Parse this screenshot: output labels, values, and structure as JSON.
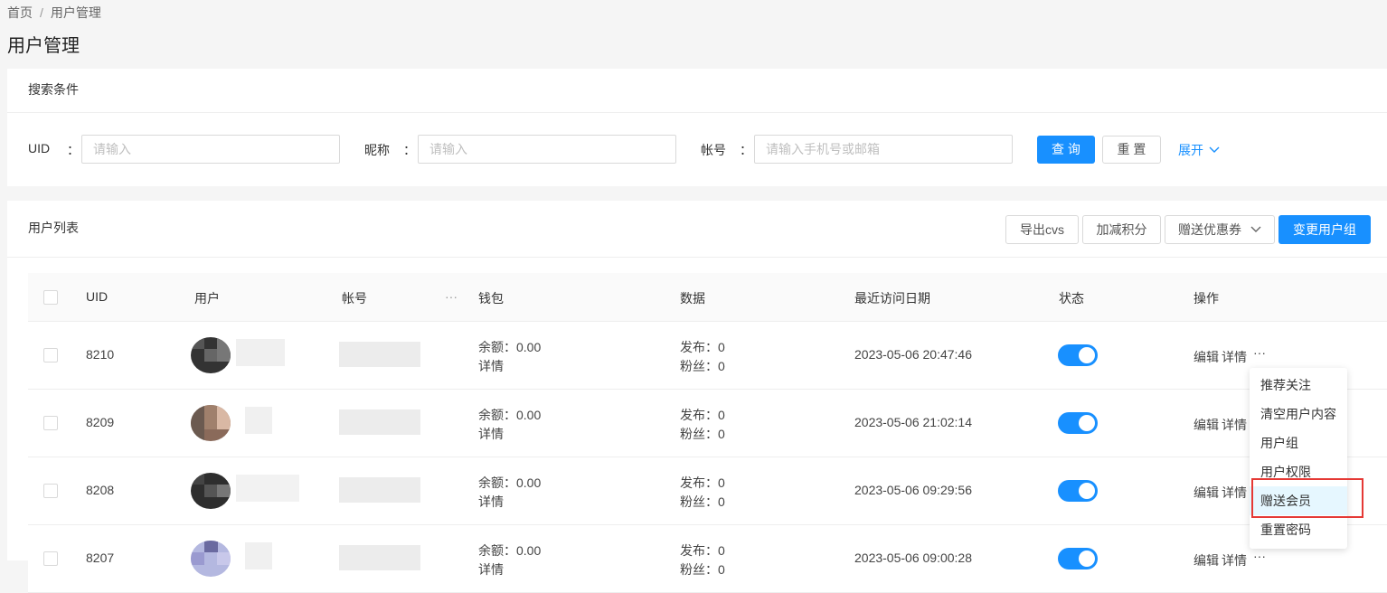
{
  "breadcrumb": {
    "home": "首页",
    "sep": "/",
    "current": "用户管理"
  },
  "page_title": "用户管理",
  "search": {
    "header": "搜索条件",
    "uid_label": "UID",
    "nickname_label": "昵称",
    "account_label": "帐号",
    "colon": "：",
    "uid_placeholder": "请输入",
    "nickname_placeholder": "请输入",
    "account_placeholder": "请输入手机号或邮箱",
    "query_button": "查 询",
    "reset_button": "重 置",
    "expand_link": "展开",
    "expand_icon": "chevron-down-icon"
  },
  "list": {
    "header": "用户列表",
    "export_button": "导出cvs",
    "points_button": "加减积分",
    "coupon_button": "赠送优惠券",
    "change_group_button": "变更用户组",
    "accent_color": "#1890ff",
    "columns": [
      "UID",
      "用户",
      "帐号",
      "钱包",
      "数据",
      "最近访问日期",
      "状态",
      "操作"
    ],
    "column_menu_icon": "···",
    "rows": [
      {
        "uid": "8210",
        "balance": "余额：0.00",
        "detail": "详情",
        "publish": "发布：0",
        "fans": "粉丝：0",
        "date": "2023-05-06 20:47:46",
        "edit": "编辑",
        "view": "详情",
        "more": "···"
      },
      {
        "uid": "8209",
        "balance": "余额：0.00",
        "detail": "详情",
        "publish": "发布：0",
        "fans": "粉丝：0",
        "date": "2023-05-06 21:02:14",
        "edit": "编辑",
        "view": "详情",
        "more": ""
      },
      {
        "uid": "8208",
        "balance": "余额：0.00",
        "detail": "详情",
        "publish": "发布：0",
        "fans": "粉丝：0",
        "date": "2023-05-06 09:29:56",
        "edit": "编辑",
        "view": "详情",
        "more": ""
      },
      {
        "uid": "8207",
        "balance": "余额：0.00",
        "detail": "详情",
        "publish": "发布：0",
        "fans": "粉丝：0",
        "date": "2023-05-06 09:00:28",
        "edit": "编辑",
        "view": "详情",
        "more": "···"
      }
    ]
  },
  "dropdown": {
    "items": [
      "推荐关注",
      "清空用户内容",
      "用户组",
      "用户权限",
      "赠送会员",
      "重置密码"
    ],
    "active_index": 4,
    "highlight_color": "#e53935"
  }
}
